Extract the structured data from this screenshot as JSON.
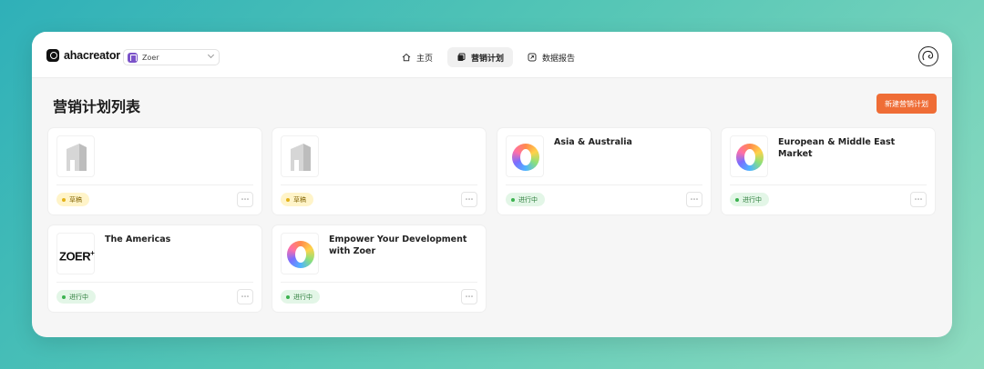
{
  "brand": {
    "name": "ahacreator"
  },
  "workspace": {
    "name": "Zoer"
  },
  "nav": [
    {
      "label": "主页",
      "icon": "home-icon",
      "active": false
    },
    {
      "label": "营销计划",
      "icon": "plan-icon",
      "active": true
    },
    {
      "label": "数据报告",
      "icon": "report-icon",
      "active": false
    }
  ],
  "page": {
    "title": "营销计划列表",
    "new_button": "新建营销计划"
  },
  "cards": [
    {
      "title": "",
      "thumb": "building-placeholder",
      "status": "草稿",
      "status_type": "draft"
    },
    {
      "title": "",
      "thumb": "building-placeholder",
      "status": "草稿",
      "status_type": "draft"
    },
    {
      "title": "Asia & Australia",
      "thumb": "ring-logo",
      "status": "进行中",
      "status_type": "active"
    },
    {
      "title": "European & Middle East Market",
      "thumb": "ring-logo",
      "status": "进行中",
      "status_type": "active"
    },
    {
      "title": "The Americas",
      "thumb": "zoer-logo",
      "thumb_text": "ZOER",
      "status": "进行中",
      "status_type": "active"
    },
    {
      "title": "Empower Your Development with Zoer",
      "thumb": "ring-logo",
      "status": "进行中",
      "status_type": "active"
    }
  ],
  "more_label": "⋯",
  "colors": {
    "accent": "#ef6d36",
    "draft": "#fff4c9",
    "active": "#e3f6e7"
  }
}
